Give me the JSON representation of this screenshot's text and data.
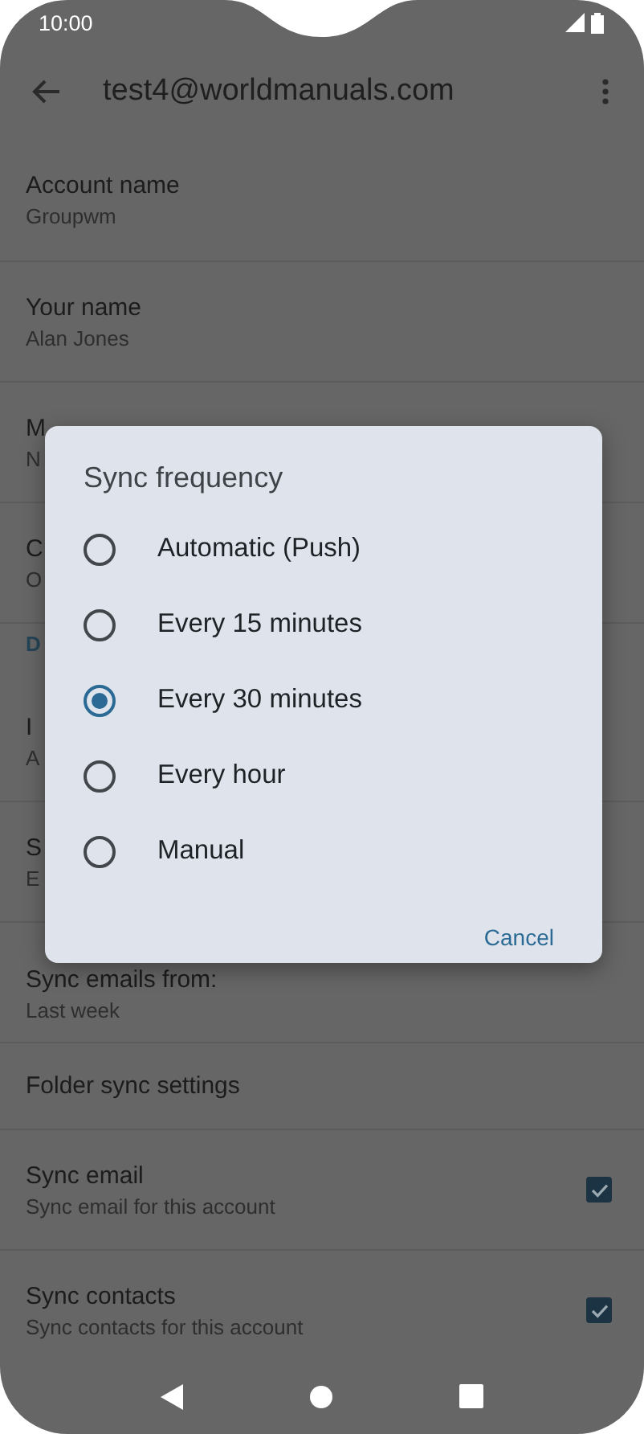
{
  "status_bar": {
    "time": "10:00"
  },
  "app_bar": {
    "title": "test4@worldmanuals.com"
  },
  "settings": [
    {
      "kind": "item",
      "title": "Account name",
      "subtitle": "Groupwm"
    },
    {
      "kind": "item",
      "title": "Your name",
      "subtitle": "Alan Jones"
    },
    {
      "kind": "item",
      "title": "M",
      "subtitle": "N"
    },
    {
      "kind": "item",
      "title": "C",
      "subtitle": "O"
    },
    {
      "kind": "header",
      "title": "D"
    },
    {
      "kind": "item",
      "title": "I",
      "subtitle": "A"
    },
    {
      "kind": "item",
      "title": "S",
      "subtitle": "E"
    },
    {
      "kind": "item",
      "title": "Sync emails from:",
      "subtitle": "Last week"
    },
    {
      "kind": "item",
      "title": "Folder sync settings"
    },
    {
      "kind": "checkbox",
      "title": "Sync email",
      "subtitle": "Sync email for this account",
      "checked": true
    },
    {
      "kind": "checkbox",
      "title": "Sync contacts",
      "subtitle": "Sync contacts for this account",
      "checked": true
    }
  ],
  "dialog": {
    "title": "Sync frequency",
    "options": [
      {
        "label": "Automatic (Push)",
        "selected": false
      },
      {
        "label": "Every 15 minutes",
        "selected": false
      },
      {
        "label": "Every 30 minutes",
        "selected": true
      },
      {
        "label": "Every hour",
        "selected": false
      },
      {
        "label": "Manual",
        "selected": false
      }
    ],
    "buttons": [
      "Cancel"
    ]
  }
}
